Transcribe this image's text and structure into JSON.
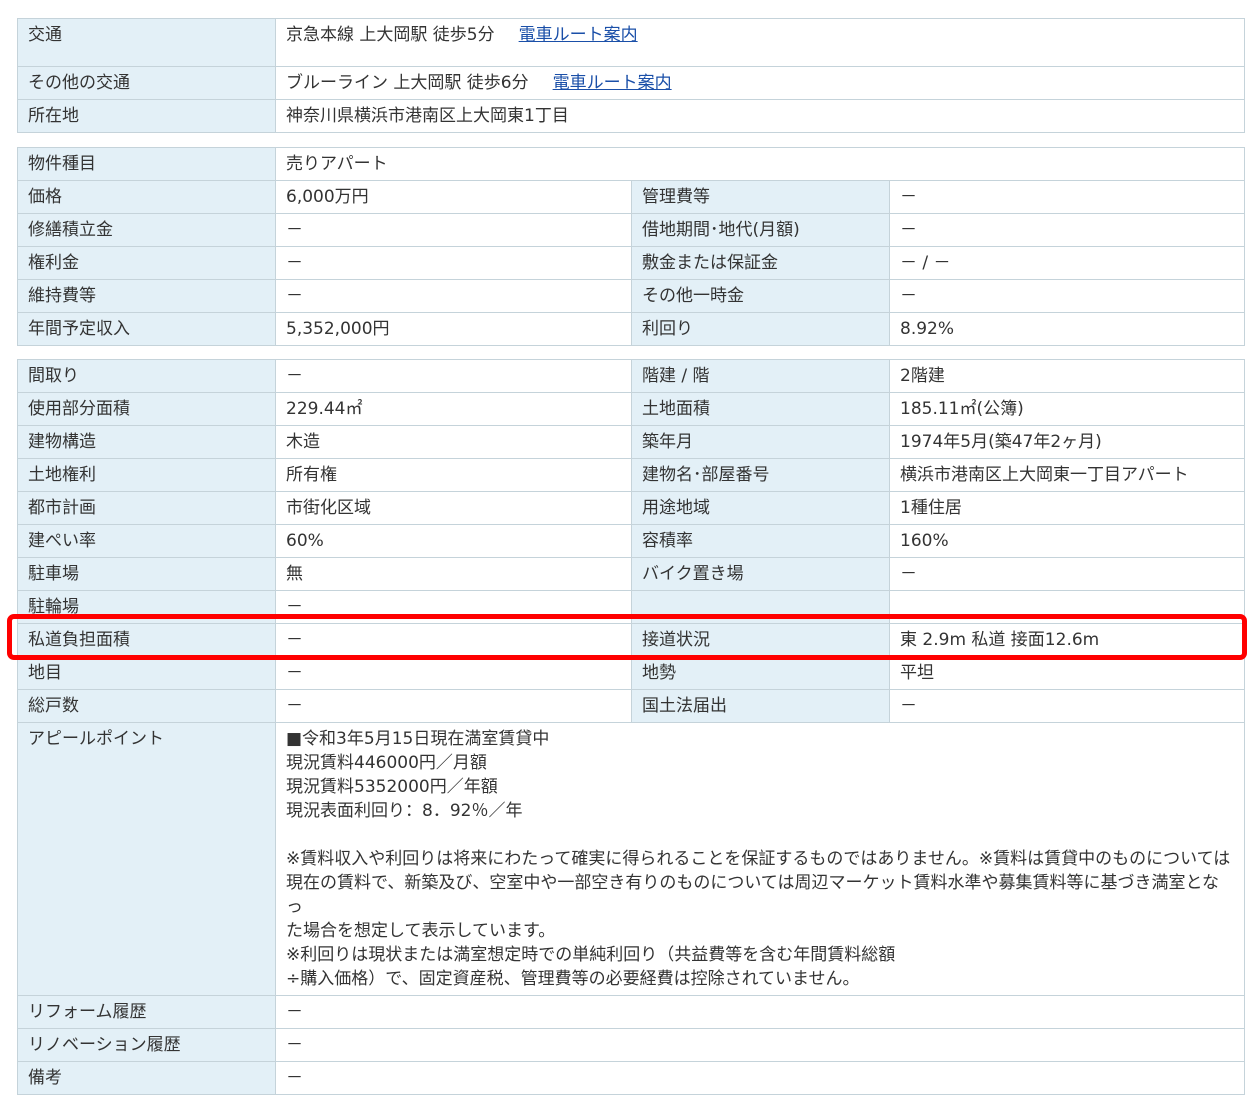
{
  "access": {
    "rows": [
      {
        "label": "交通",
        "value": "京急本線 上大岡駅 徒歩5分",
        "link": "電車ルート案内"
      },
      {
        "label": "その他の交通",
        "value": "ブルーライン 上大岡駅 徒歩6分",
        "link": "電車ルート案内"
      },
      {
        "label": "所在地",
        "value": "神奈川県横浜市港南区上大岡東1丁目"
      }
    ]
  },
  "price": {
    "type_label": "物件種目",
    "type_value": "売りアパート",
    "rows": [
      {
        "l1": "価格",
        "v1": "6,000万円",
        "l2": "管理費等",
        "v2": "－"
      },
      {
        "l1": "修繕積立金",
        "v1": "－",
        "l2": "借地期間･地代(月額)",
        "v2": "－"
      },
      {
        "l1": "権利金",
        "v1": "－",
        "l2": "敷金または保証金",
        "v2": "－ / －"
      },
      {
        "l1": "維持費等",
        "v1": "－",
        "l2": "その他一時金",
        "v2": "－"
      },
      {
        "l1": "年間予定収入",
        "v1": "5,352,000円",
        "l2": "利回り",
        "v2": "8.92%"
      }
    ]
  },
  "details": {
    "rows": [
      {
        "l1": "間取り",
        "v1": "－",
        "l2": "階建 / 階",
        "v2": "2階建"
      },
      {
        "l1": "使用部分面積",
        "v1": "229.44㎡",
        "l2": "土地面積",
        "v2": "185.11㎡(公簿)"
      },
      {
        "l1": "建物構造",
        "v1": "木造",
        "l2": "築年月",
        "v2": "1974年5月(築47年2ヶ月)"
      },
      {
        "l1": "土地権利",
        "v1": "所有権",
        "l2": "建物名･部屋番号",
        "v2": "横浜市港南区上大岡東一丁目アパート"
      },
      {
        "l1": "都市計画",
        "v1": "市街化区域",
        "l2": "用途地域",
        "v2": "1種住居"
      },
      {
        "l1": "建ぺい率",
        "v1": "60%",
        "l2": "容積率",
        "v2": "160%"
      },
      {
        "l1": "駐車場",
        "v1": "無",
        "l2": "バイク置き場",
        "v2": "－"
      },
      {
        "l1": "駐輪場",
        "v1": "－",
        "l2": "",
        "v2": ""
      },
      {
        "l1": "私道負担面積",
        "v1": "－",
        "l2": "接道状況",
        "v2": "東 2.9m 私道 接面12.6m"
      },
      {
        "l1": "地目",
        "v1": "－",
        "l2": "地勢",
        "v2": "平坦"
      },
      {
        "l1": "総戸数",
        "v1": "－",
        "l2": "国土法届出",
        "v2": "－"
      }
    ],
    "appeal_label": "アピールポイント",
    "appeal_lines": [
      "■令和3年5月15日現在満室賃貸中",
      "現況賃料446000円／月額",
      "現況賃料5352000円／年額",
      "現況表面利回り：8．92％／年",
      "",
      "※賃料収入や利回りは将来にわたって確実に得られることを保証するものではありません。※賃料は賃貸中のものについては",
      "現在の賃料で、新築及び、空室中や一部空き有りのものについては周辺マーケット賃料水準や募集賃料等に基づき満室となっ",
      "た場合を想定して表示しています。",
      "※利回りは現状または満室想定時での単純利回り（共益費等を含む年間賃料総額",
      "÷購入価格）で、固定資産税、管理費等の必要経費は控除されていません。"
    ],
    "reform_label": "リフォーム履歴",
    "reform_value": "－",
    "renovation_label": "リノベーション履歴",
    "renovation_value": "－",
    "remarks_label": "備考",
    "remarks_value": "－"
  }
}
